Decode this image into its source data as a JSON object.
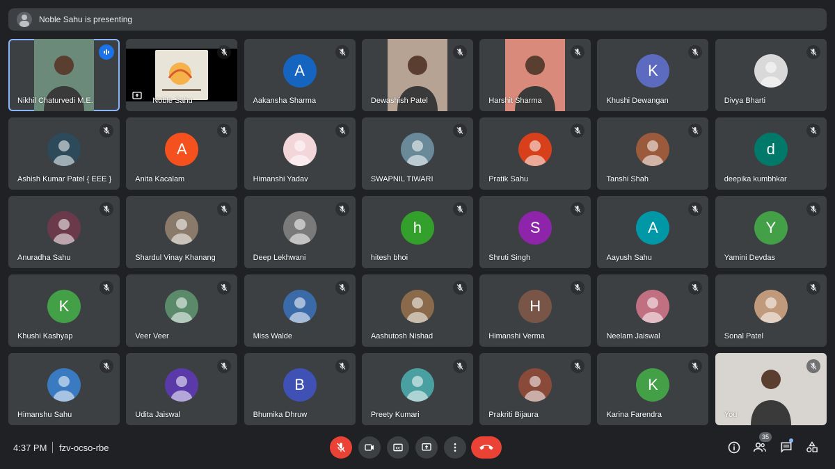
{
  "banner": {
    "text": "Noble Sahu is presenting"
  },
  "tiles": [
    {
      "name": "Nikhil Chaturvedi M.E.",
      "kind": "video",
      "bg": "#6b8a7a",
      "speaking": true
    },
    {
      "name": "Noble Sahu",
      "kind": "screen",
      "bg": "#e9e4d8"
    },
    {
      "name": "Aakansha Sharma",
      "kind": "letter",
      "letter": "A",
      "color": "#1565c0"
    },
    {
      "name": "Dewashish Patel",
      "kind": "video",
      "bg": "#b6a394"
    },
    {
      "name": "Harshit Sharma",
      "kind": "video",
      "bg": "#d98a7a"
    },
    {
      "name": "Khushi Dewangan",
      "kind": "letter",
      "letter": "K",
      "color": "#5c6bc0"
    },
    {
      "name": "Divya Bharti",
      "kind": "photo",
      "color": "#d9d9d9"
    },
    {
      "name": "Ashish Kumar Patel { EEE }",
      "kind": "photo",
      "color": "#2c4a5a"
    },
    {
      "name": "Anita Kacalam",
      "kind": "letter",
      "letter": "A",
      "color": "#f4511e"
    },
    {
      "name": "Himanshi Yadav",
      "kind": "photo",
      "color": "#f3d6da"
    },
    {
      "name": "SWAPNIL TIWARI",
      "kind": "photo",
      "color": "#6a8a9a"
    },
    {
      "name": "Pratik Sahu",
      "kind": "photo",
      "color": "#d8401c"
    },
    {
      "name": "Tanshi Shah",
      "kind": "photo",
      "color": "#9c5a3c"
    },
    {
      "name": "deepika kumbhkar",
      "kind": "letter",
      "letter": "d",
      "color": "#00796b"
    },
    {
      "name": "Anuradha Sahu",
      "kind": "photo",
      "color": "#6a3a4a"
    },
    {
      "name": "Shardul Vinay Khanang",
      "kind": "photo",
      "color": "#8a7a6a"
    },
    {
      "name": "Deep Lekhwani",
      "kind": "photo",
      "color": "#7a7a7a"
    },
    {
      "name": "hitesh bhoi",
      "kind": "letter",
      "letter": "h",
      "color": "#33a02c"
    },
    {
      "name": "Shruti Singh",
      "kind": "letter",
      "letter": "S",
      "color": "#8e24aa"
    },
    {
      "name": "Aayush Sahu",
      "kind": "letter",
      "letter": "A",
      "color": "#0097a7"
    },
    {
      "name": "Yamini Devdas",
      "kind": "letter",
      "letter": "Y",
      "color": "#43a047"
    },
    {
      "name": "Khushi Kashyap",
      "kind": "letter",
      "letter": "K",
      "color": "#43a047"
    },
    {
      "name": "Veer Veer",
      "kind": "photo",
      "color": "#5a8a6a"
    },
    {
      "name": "Miss Walde",
      "kind": "photo",
      "color": "#3a6aa8"
    },
    {
      "name": "Aashutosh Nishad",
      "kind": "photo",
      "color": "#8a6a4a"
    },
    {
      "name": "Himanshi Verma",
      "kind": "letter",
      "letter": "H",
      "color": "#795548"
    },
    {
      "name": "Neelam Jaiswal",
      "kind": "photo",
      "color": "#c07080"
    },
    {
      "name": "Sonal Patel",
      "kind": "photo",
      "color": "#c09a7a"
    },
    {
      "name": "Himanshu Sahu",
      "kind": "photo",
      "color": "#3a7ac0"
    },
    {
      "name": "Udita Jaiswal",
      "kind": "photo",
      "color": "#5a3aa8"
    },
    {
      "name": "Bhumika Dhruw",
      "kind": "letter",
      "letter": "B",
      "color": "#3f51b5"
    },
    {
      "name": "Preety Kumari",
      "kind": "photo",
      "color": "#4aa0a0"
    },
    {
      "name": "Prakriti Bijaura",
      "kind": "photo",
      "color": "#8a4a3a"
    },
    {
      "name": "Karina Farendra",
      "kind": "letter",
      "letter": "K",
      "color": "#43a047"
    },
    {
      "name": "You",
      "kind": "self",
      "bg": "#d8d4d0"
    }
  ],
  "bottombar": {
    "time": "4:37 PM",
    "meeting_code": "fzv-ocso-rbe",
    "participants_count": "35"
  },
  "icons": {
    "mic_off": "mic-off-icon",
    "camera": "camera-icon",
    "captions": "captions-icon",
    "present": "present-icon",
    "more": "more-icon",
    "end_call": "end-call-icon",
    "info": "info-icon",
    "people": "people-icon",
    "chat": "chat-icon",
    "activities": "activities-icon"
  },
  "colors": {
    "accent": "#8ab4f8",
    "danger": "#ea4335",
    "tile_bg": "#3c4043",
    "page_bg": "#202124"
  }
}
